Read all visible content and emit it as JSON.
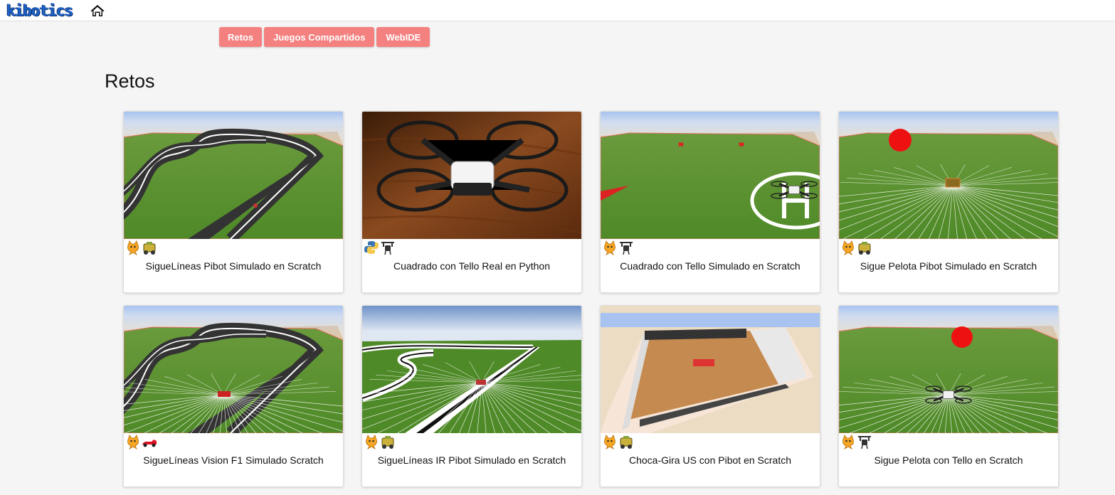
{
  "header": {
    "logo_text": "kibotics",
    "home_icon": "home-icon"
  },
  "nav": {
    "buttons": [
      "Retos",
      "Juegos Compartidos",
      "WebIDE"
    ],
    "color": "#f48080"
  },
  "page": {
    "title": "Retos"
  },
  "cards": [
    {
      "title": "SigueLíneas Pibot Simulado en Scratch",
      "icons": [
        "scratch-cat-icon",
        "pibot-robot-icon"
      ],
      "scene": "line-track"
    },
    {
      "title": "Cuadrado con Tello Real en Python",
      "icons": [
        "python-icon",
        "drone-icon"
      ],
      "scene": "real-drone"
    },
    {
      "title": "Cuadrado con Tello Simulado en Scratch",
      "icons": [
        "scratch-cat-icon",
        "drone-icon"
      ],
      "scene": "drone-helipad"
    },
    {
      "title": "Sigue Pelota Pibot Simulado en Scratch",
      "icons": [
        "scratch-cat-icon",
        "pibot-robot-icon"
      ],
      "scene": "ball-pibot"
    },
    {
      "title": "SigueLíneas Vision F1 Simulado Scratch",
      "icons": [
        "scratch-cat-icon",
        "f1-car-icon"
      ],
      "scene": "line-track-f1"
    },
    {
      "title": "SigueLíneas IR Pibot Simulado en Scratch",
      "icons": [
        "scratch-cat-icon",
        "pibot-robot-icon"
      ],
      "scene": "line-track-ir"
    },
    {
      "title": "Choca-Gira US con Pibot en Scratch",
      "icons": [
        "scratch-cat-icon",
        "pibot-robot-icon"
      ],
      "scene": "room"
    },
    {
      "title": "Sigue Pelota con Tello en Scratch",
      "icons": [
        "scratch-cat-icon",
        "drone-icon"
      ],
      "scene": "ball-drone"
    }
  ]
}
